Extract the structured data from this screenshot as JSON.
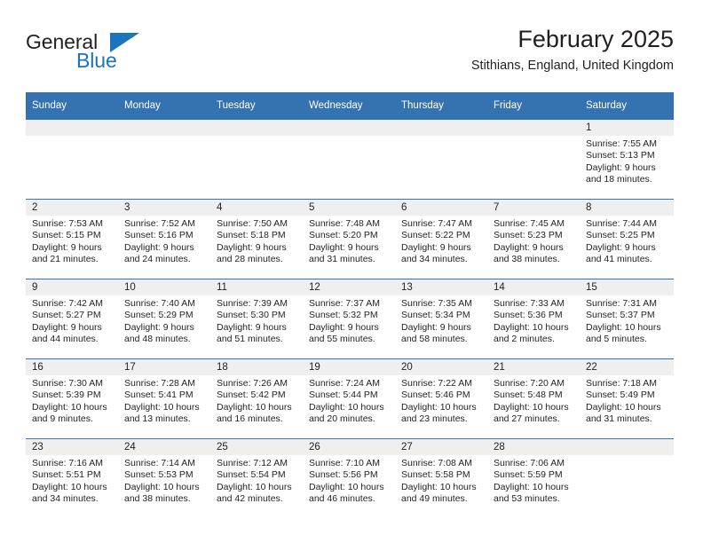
{
  "brand": {
    "name_top": "General",
    "name_bottom": "Blue",
    "flag_icon": "blue-triangle-flag",
    "color_text": "#231f20",
    "color_blue": "#1b75bb"
  },
  "header": {
    "title": "February 2025",
    "subtitle": "Stithians, England, United Kingdom"
  },
  "theme": {
    "header_blue": "#3572b0",
    "daynum_gray": "#efefef",
    "text": "#231f20"
  },
  "calendar": {
    "weekday_headers": [
      "Sunday",
      "Monday",
      "Tuesday",
      "Wednesday",
      "Thursday",
      "Friday",
      "Saturday"
    ],
    "weeks": [
      [
        {
          "day": "",
          "blank": true
        },
        {
          "day": "",
          "blank": true
        },
        {
          "day": "",
          "blank": true
        },
        {
          "day": "",
          "blank": true
        },
        {
          "day": "",
          "blank": true
        },
        {
          "day": "",
          "blank": true
        },
        {
          "day": "1",
          "sunrise": "Sunrise: 7:55 AM",
          "sunset": "Sunset: 5:13 PM",
          "daylight": "Daylight: 9 hours and 18 minutes."
        }
      ],
      [
        {
          "day": "2",
          "sunrise": "Sunrise: 7:53 AM",
          "sunset": "Sunset: 5:15 PM",
          "daylight": "Daylight: 9 hours and 21 minutes."
        },
        {
          "day": "3",
          "sunrise": "Sunrise: 7:52 AM",
          "sunset": "Sunset: 5:16 PM",
          "daylight": "Daylight: 9 hours and 24 minutes."
        },
        {
          "day": "4",
          "sunrise": "Sunrise: 7:50 AM",
          "sunset": "Sunset: 5:18 PM",
          "daylight": "Daylight: 9 hours and 28 minutes."
        },
        {
          "day": "5",
          "sunrise": "Sunrise: 7:48 AM",
          "sunset": "Sunset: 5:20 PM",
          "daylight": "Daylight: 9 hours and 31 minutes."
        },
        {
          "day": "6",
          "sunrise": "Sunrise: 7:47 AM",
          "sunset": "Sunset: 5:22 PM",
          "daylight": "Daylight: 9 hours and 34 minutes."
        },
        {
          "day": "7",
          "sunrise": "Sunrise: 7:45 AM",
          "sunset": "Sunset: 5:23 PM",
          "daylight": "Daylight: 9 hours and 38 minutes."
        },
        {
          "day": "8",
          "sunrise": "Sunrise: 7:44 AM",
          "sunset": "Sunset: 5:25 PM",
          "daylight": "Daylight: 9 hours and 41 minutes."
        }
      ],
      [
        {
          "day": "9",
          "sunrise": "Sunrise: 7:42 AM",
          "sunset": "Sunset: 5:27 PM",
          "daylight": "Daylight: 9 hours and 44 minutes."
        },
        {
          "day": "10",
          "sunrise": "Sunrise: 7:40 AM",
          "sunset": "Sunset: 5:29 PM",
          "daylight": "Daylight: 9 hours and 48 minutes."
        },
        {
          "day": "11",
          "sunrise": "Sunrise: 7:39 AM",
          "sunset": "Sunset: 5:30 PM",
          "daylight": "Daylight: 9 hours and 51 minutes."
        },
        {
          "day": "12",
          "sunrise": "Sunrise: 7:37 AM",
          "sunset": "Sunset: 5:32 PM",
          "daylight": "Daylight: 9 hours and 55 minutes."
        },
        {
          "day": "13",
          "sunrise": "Sunrise: 7:35 AM",
          "sunset": "Sunset: 5:34 PM",
          "daylight": "Daylight: 9 hours and 58 minutes."
        },
        {
          "day": "14",
          "sunrise": "Sunrise: 7:33 AM",
          "sunset": "Sunset: 5:36 PM",
          "daylight": "Daylight: 10 hours and 2 minutes."
        },
        {
          "day": "15",
          "sunrise": "Sunrise: 7:31 AM",
          "sunset": "Sunset: 5:37 PM",
          "daylight": "Daylight: 10 hours and 5 minutes."
        }
      ],
      [
        {
          "day": "16",
          "sunrise": "Sunrise: 7:30 AM",
          "sunset": "Sunset: 5:39 PM",
          "daylight": "Daylight: 10 hours and 9 minutes."
        },
        {
          "day": "17",
          "sunrise": "Sunrise: 7:28 AM",
          "sunset": "Sunset: 5:41 PM",
          "daylight": "Daylight: 10 hours and 13 minutes."
        },
        {
          "day": "18",
          "sunrise": "Sunrise: 7:26 AM",
          "sunset": "Sunset: 5:42 PM",
          "daylight": "Daylight: 10 hours and 16 minutes."
        },
        {
          "day": "19",
          "sunrise": "Sunrise: 7:24 AM",
          "sunset": "Sunset: 5:44 PM",
          "daylight": "Daylight: 10 hours and 20 minutes."
        },
        {
          "day": "20",
          "sunrise": "Sunrise: 7:22 AM",
          "sunset": "Sunset: 5:46 PM",
          "daylight": "Daylight: 10 hours and 23 minutes."
        },
        {
          "day": "21",
          "sunrise": "Sunrise: 7:20 AM",
          "sunset": "Sunset: 5:48 PM",
          "daylight": "Daylight: 10 hours and 27 minutes."
        },
        {
          "day": "22",
          "sunrise": "Sunrise: 7:18 AM",
          "sunset": "Sunset: 5:49 PM",
          "daylight": "Daylight: 10 hours and 31 minutes."
        }
      ],
      [
        {
          "day": "23",
          "sunrise": "Sunrise: 7:16 AM",
          "sunset": "Sunset: 5:51 PM",
          "daylight": "Daylight: 10 hours and 34 minutes."
        },
        {
          "day": "24",
          "sunrise": "Sunrise: 7:14 AM",
          "sunset": "Sunset: 5:53 PM",
          "daylight": "Daylight: 10 hours and 38 minutes."
        },
        {
          "day": "25",
          "sunrise": "Sunrise: 7:12 AM",
          "sunset": "Sunset: 5:54 PM",
          "daylight": "Daylight: 10 hours and 42 minutes."
        },
        {
          "day": "26",
          "sunrise": "Sunrise: 7:10 AM",
          "sunset": "Sunset: 5:56 PM",
          "daylight": "Daylight: 10 hours and 46 minutes."
        },
        {
          "day": "27",
          "sunrise": "Sunrise: 7:08 AM",
          "sunset": "Sunset: 5:58 PM",
          "daylight": "Daylight: 10 hours and 49 minutes."
        },
        {
          "day": "28",
          "sunrise": "Sunrise: 7:06 AM",
          "sunset": "Sunset: 5:59 PM",
          "daylight": "Daylight: 10 hours and 53 minutes."
        },
        {
          "day": "",
          "blank": true
        }
      ]
    ]
  }
}
